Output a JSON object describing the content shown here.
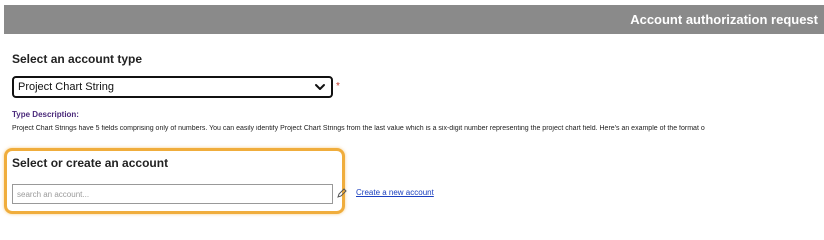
{
  "header": {
    "title": "Account authorization request"
  },
  "account_type": {
    "section_title": "Select an account type",
    "selected_value": "Project Chart String",
    "required_marker": "*"
  },
  "type_description": {
    "label": "Type Description:",
    "text": "Project Chart Strings have 5 fields comprising only of numbers. You can easily identify Project Chart Strings from the last value which is a six-digit number representing the project chart field. Here's an example of the format o"
  },
  "account": {
    "section_title": "Select or create an account",
    "search_placeholder": "search an account...",
    "create_link": "Create a new account"
  },
  "colors": {
    "header_bg": "#8a8a8a",
    "highlight": "#f0ad3c",
    "link": "#1a3fbf",
    "label_purple": "#4b2a7b"
  },
  "icons": {
    "dropdown": "chevron-down-icon",
    "edit": "pencil-icon"
  }
}
